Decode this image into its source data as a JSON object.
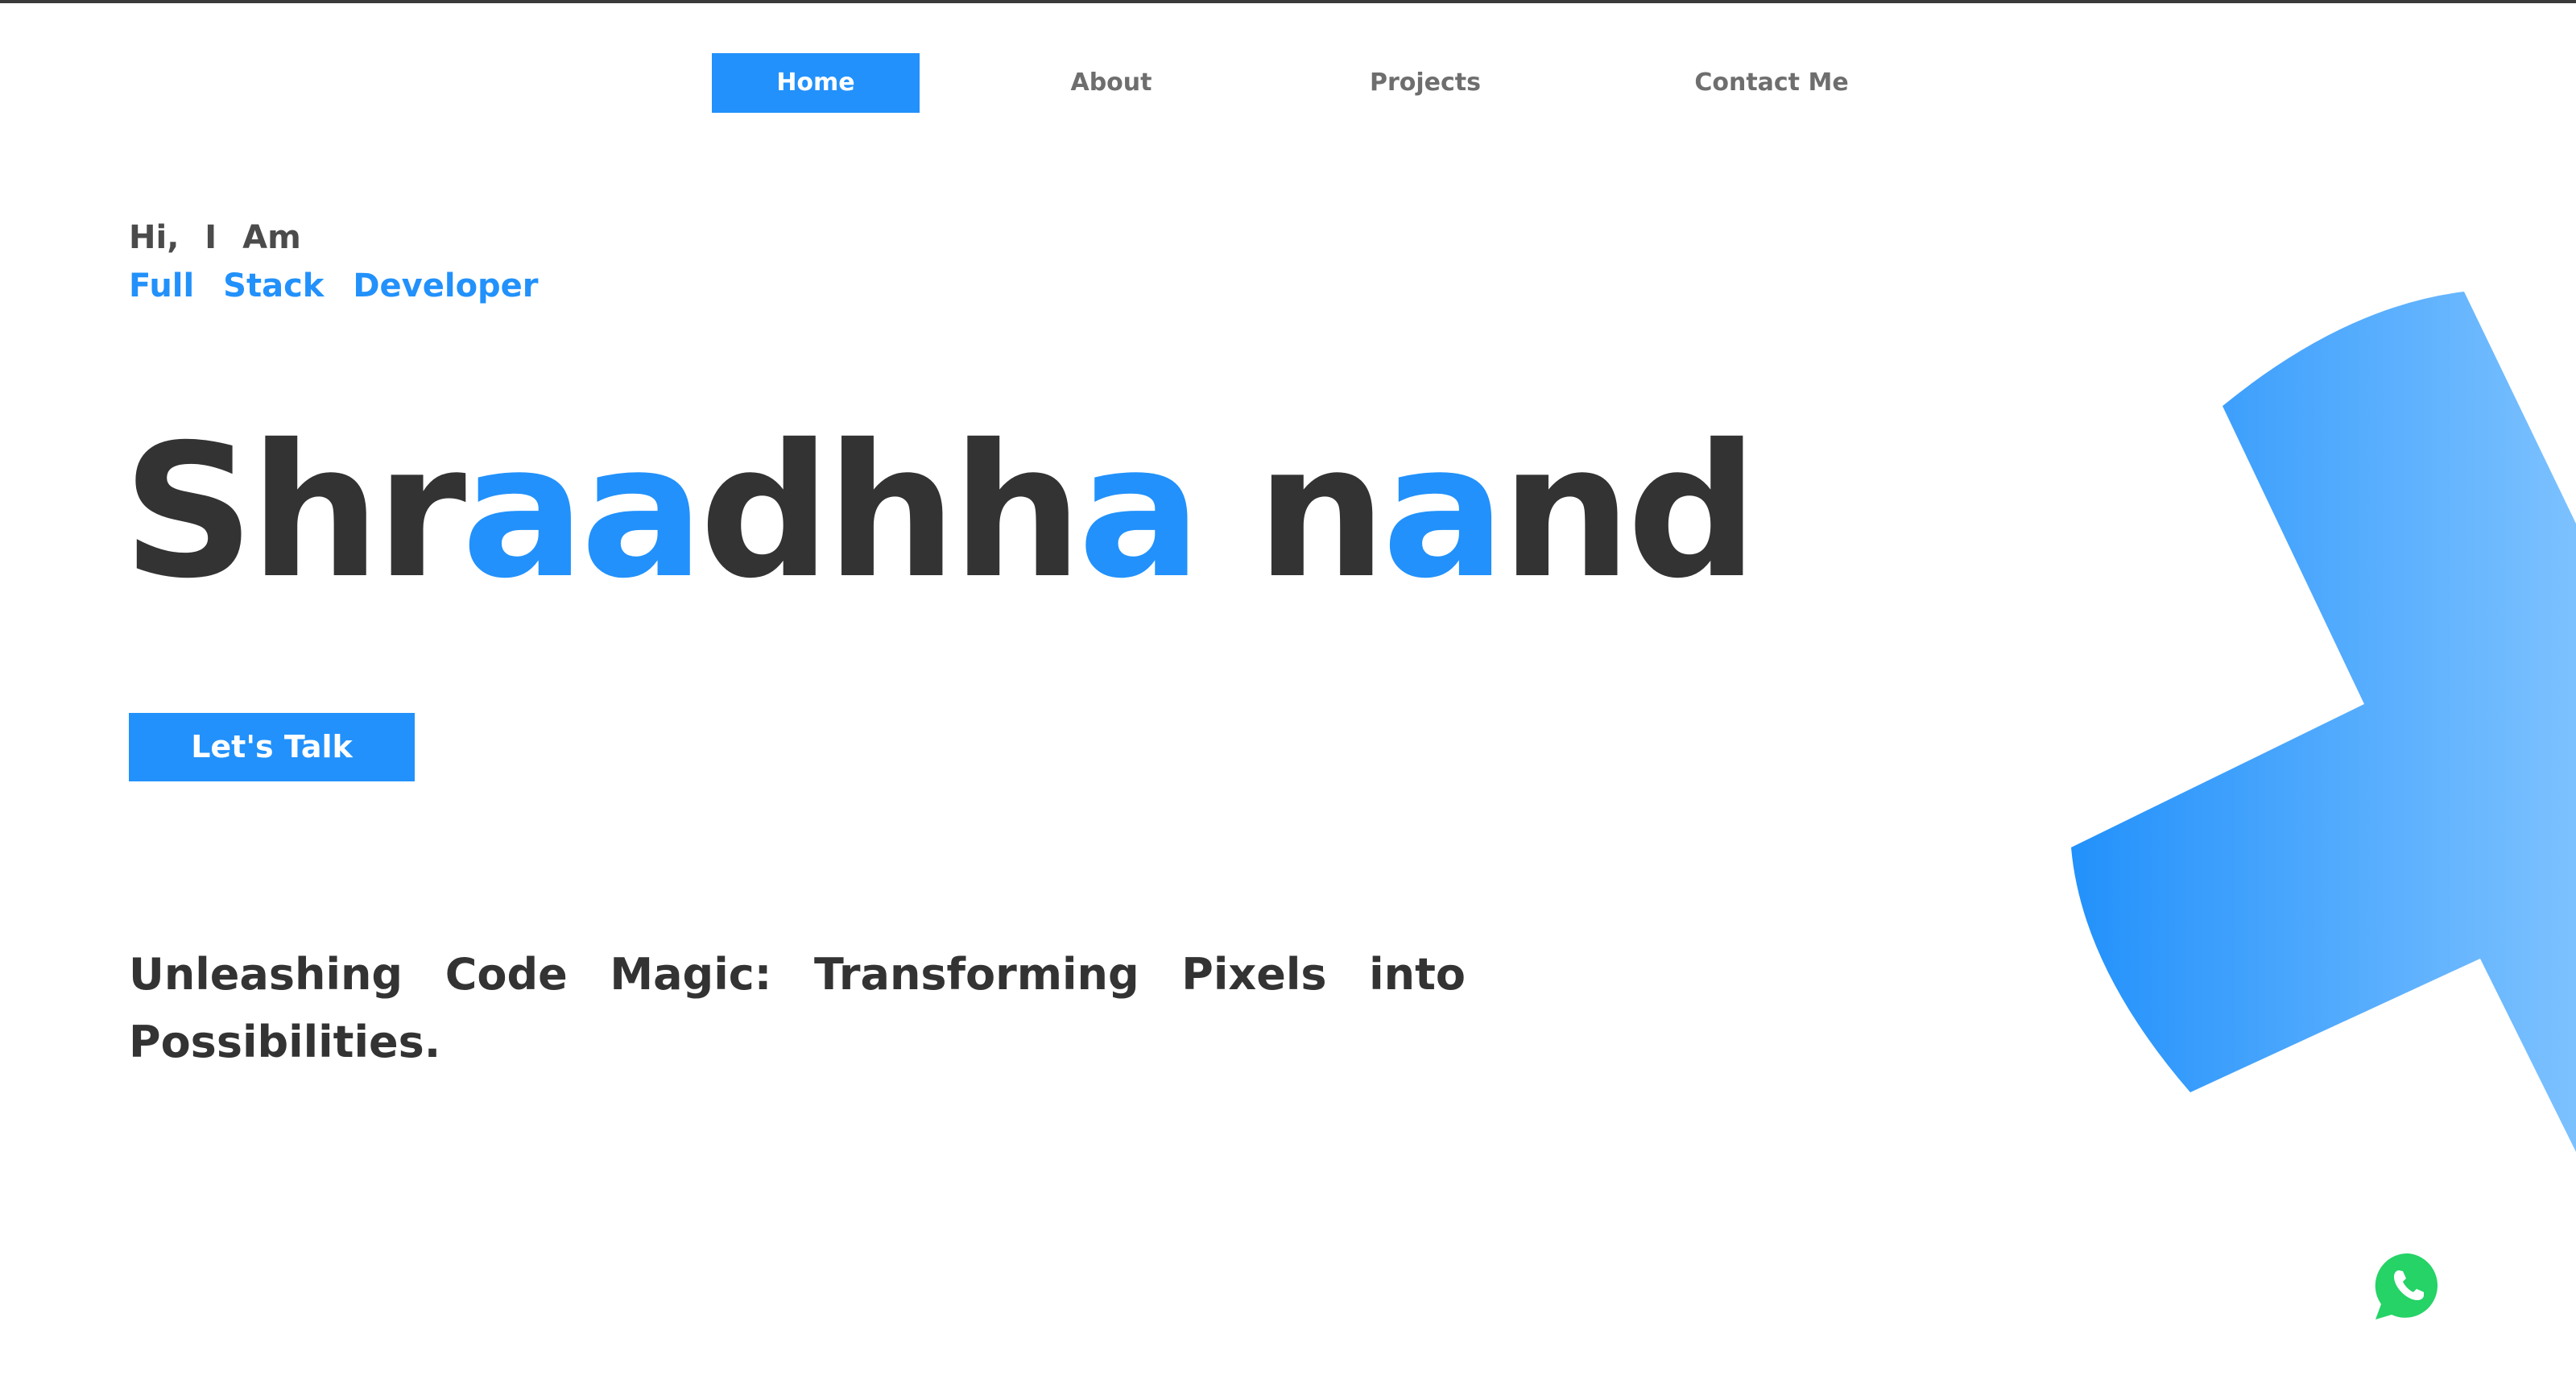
{
  "nav": {
    "items": [
      {
        "label": "Home",
        "active": true
      },
      {
        "label": "About",
        "active": false
      },
      {
        "label": "Projects",
        "active": false
      },
      {
        "label": "Contact Me",
        "active": false
      }
    ]
  },
  "hero": {
    "greeting": "Hi, I Am",
    "role": "Full Stack Developer",
    "name_parts": {
      "p1": "Shr",
      "p2": "aa",
      "p3": "dhh",
      "p4": "a",
      "p5": "n",
      "p6": "a",
      "p7": "nd"
    },
    "cta_label": "Let's Talk",
    "tagline": "Unleashing Code Magic: Transforming Pixels into Possibilities."
  },
  "colors": {
    "accent": "#2291fb",
    "text_dark": "#333333",
    "nav_text": "#6e6e6e",
    "whatsapp_green": "#25d366"
  },
  "icons": {
    "floating_action": "whatsapp-icon",
    "decoration": "gradient-cross-shape"
  }
}
